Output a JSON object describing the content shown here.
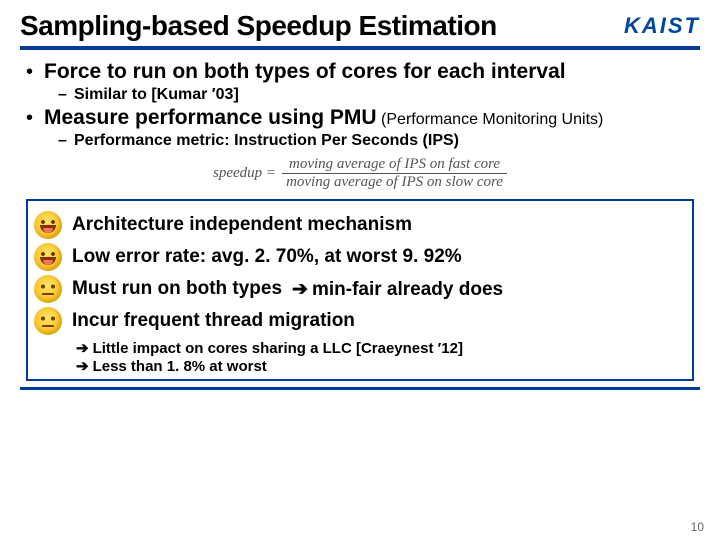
{
  "header": {
    "title": "Sampling-based Speedup Estimation",
    "logo": "KAIST"
  },
  "bullets": {
    "b1": "Force to run on both types of cores for each interval",
    "b1a": "Similar to [Kumar ′03]",
    "b2_pre": "Measure performance using PMU",
    "b2_paren": " (Performance Monitoring Units)",
    "b2a": "Performance metric: Instruction Per Seconds (IPS)"
  },
  "formula": {
    "lhs": "speedup =",
    "num": "moving average of IPS on fast core",
    "den": "moving average of IPS on slow core"
  },
  "box": {
    "r1": "Architecture independent mechanism",
    "r2": "Low error rate: avg. 2. 70%, at worst 9. 92%",
    "r3": "Must run on both types",
    "r3_aside": "min-fair already does",
    "r4": "Incur frequent thread migration",
    "r4a": "Little impact on cores sharing a LLC [Craeynest ′12]",
    "r4b": "Less than 1. 8% at worst"
  },
  "glyphs": {
    "arrow": "➔"
  },
  "page": "10"
}
